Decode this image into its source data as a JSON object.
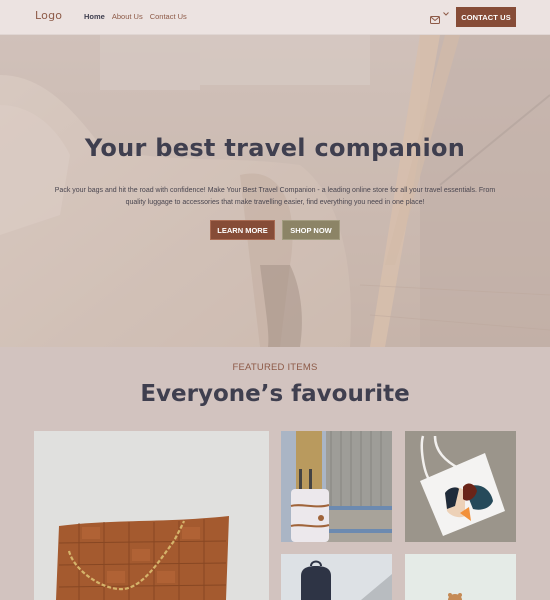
{
  "header": {
    "logo": "Logo",
    "nav": [
      {
        "label": "Home",
        "active": true
      },
      {
        "label": "About Us",
        "active": false
      },
      {
        "label": "Contact Us",
        "active": false
      }
    ],
    "mail_icon": "envelope-icon",
    "dropdown_icon": "chevron-down-icon",
    "contact_button": "CONTACT US"
  },
  "hero": {
    "title": "Your best travel companion",
    "description": "Pack your bags and hit the road with confidence! Make Your Best Travel Companion - a leading online store for all your travel essentials. From quality luggage to accessories that make travelling easier, find everything you need in one place!",
    "learn_more": "LEARN MORE",
    "shop_now": "SHOP NOW"
  },
  "featured": {
    "label": "FEATURED ITEMS",
    "title": "Everyone’s favourite",
    "items": [
      {
        "name": "woven-leather-bag-image"
      },
      {
        "name": "white-suitcase-image"
      },
      {
        "name": "printed-tote-bag-image"
      },
      {
        "name": "backpack-image"
      },
      {
        "name": "teddy-bear-image"
      }
    ]
  },
  "colors": {
    "accent": "#864c37",
    "secondary": "#8c8466",
    "text_dark": "#3f3f4f",
    "header_bg": "#ece3e1",
    "section_bg": "#d2c3bf"
  }
}
